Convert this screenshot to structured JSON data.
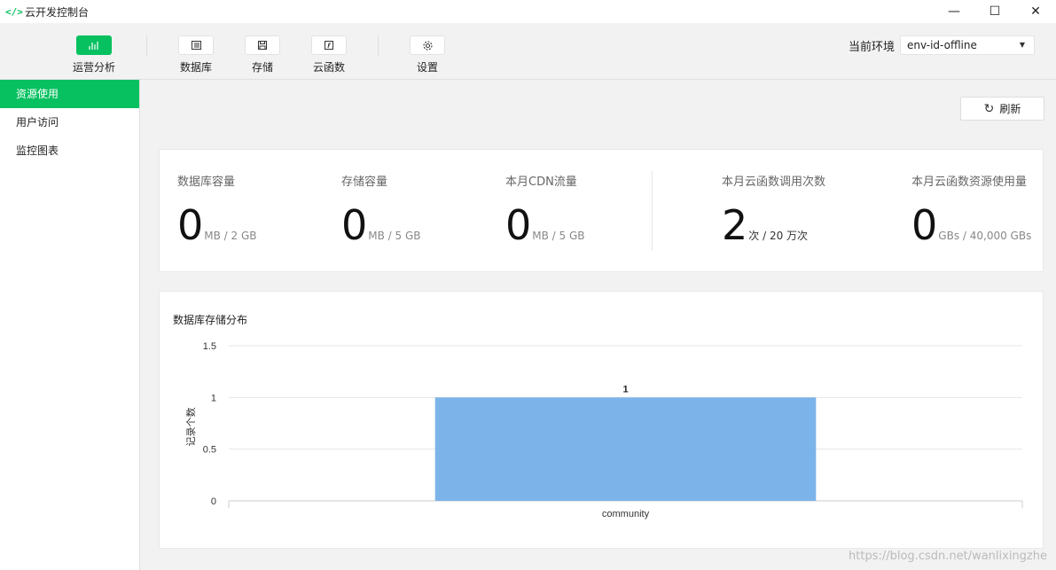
{
  "window": {
    "app_icon": "</>",
    "title": "云开发控制台",
    "minimize": "—",
    "maximize": "☐",
    "close": "✕"
  },
  "toolbar": {
    "tools": [
      {
        "label": "运营分析",
        "icon": "bar-chart-icon",
        "active": true
      },
      {
        "label": "数据库",
        "icon": "database-icon",
        "active": false
      },
      {
        "label": "存储",
        "icon": "save-disk-icon",
        "active": false
      },
      {
        "label": "云函数",
        "icon": "function-icon",
        "active": false
      },
      {
        "label": "设置",
        "icon": "gear-icon",
        "active": false
      }
    ],
    "env_label": "当前环境",
    "env_value": "env-id-offline",
    "env_caret": "▼"
  },
  "sidebar": {
    "items": [
      {
        "label": "资源使用",
        "active": true
      },
      {
        "label": "用户访问",
        "active": false
      },
      {
        "label": "监控图表",
        "active": false
      }
    ]
  },
  "main": {
    "refresh_icon": "↻",
    "refresh_label": "刷新",
    "stats": [
      {
        "label": "数据库容量",
        "value": "0",
        "unit": "MB / 2 GB"
      },
      {
        "label": "存储容量",
        "value": "0",
        "unit": "MB / 5 GB"
      },
      {
        "label": "本月CDN流量",
        "value": "0",
        "unit": "MB / 5 GB"
      },
      {
        "label": "本月云函数调用次数",
        "value": "2",
        "unit": "次 / 20 万次"
      },
      {
        "label": "本月云函数资源使用量",
        "value": "0",
        "unit": "GBs / 40,000 GBs"
      }
    ],
    "chart_title": "数据库存储分布"
  },
  "chart_data": {
    "type": "bar",
    "title": "数据库存储分布",
    "categories": [
      "community"
    ],
    "values": [
      1
    ],
    "ylabel": "记录个数",
    "xlabel": "",
    "ylim": [
      0,
      1.5
    ],
    "yticks": [
      "0",
      "0.5",
      "1",
      "1.5"
    ],
    "data_labels": [
      "1"
    ],
    "bar_color": "#7cb4ea",
    "grid": true,
    "grid_color": "#e6e6e6"
  },
  "watermark": "https://blog.csdn.net/wanlixingzhe",
  "colors": {
    "accent": "#07c160"
  }
}
